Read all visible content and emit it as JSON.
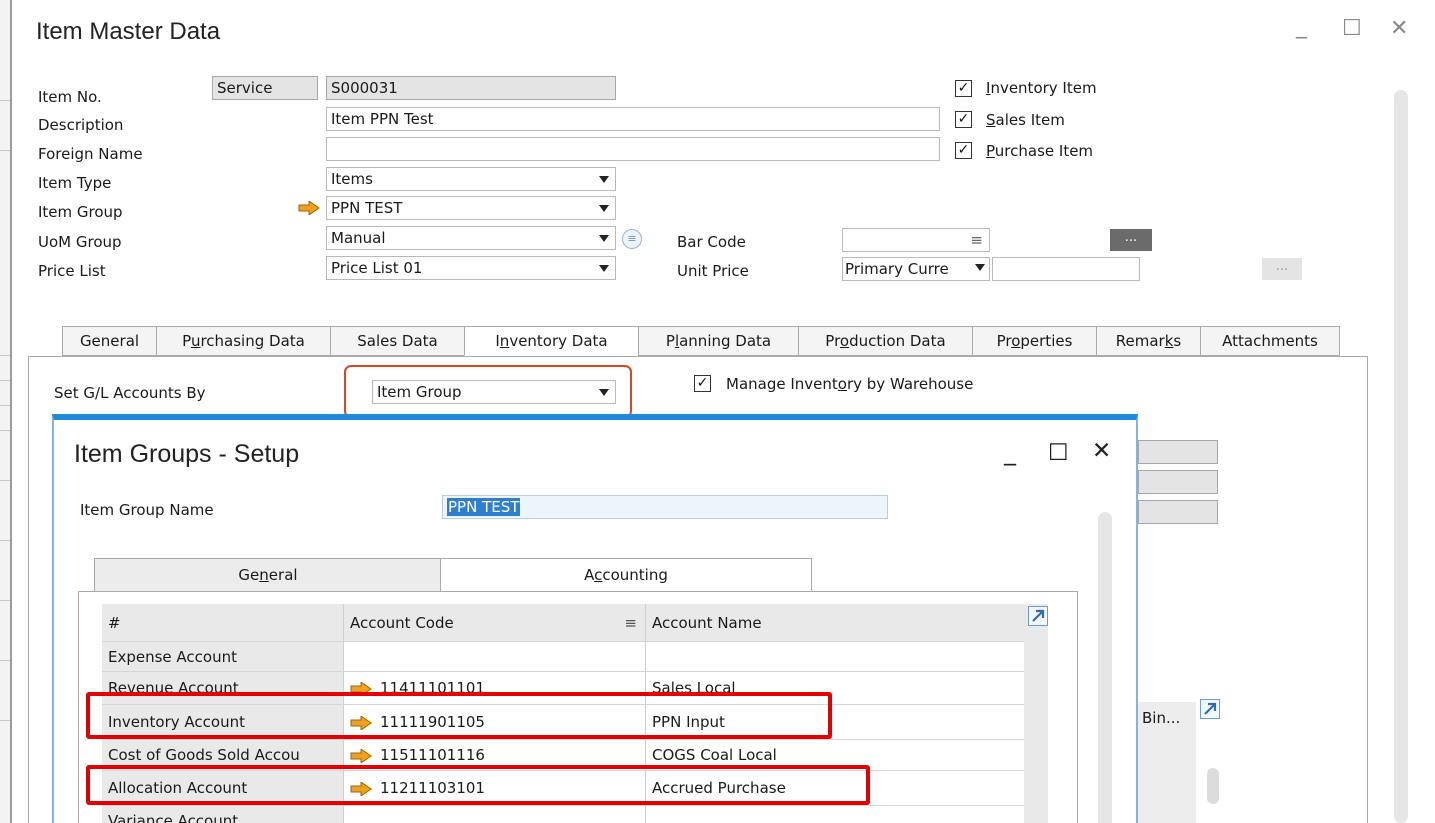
{
  "window": {
    "title": "Item Master Data",
    "controls": {
      "minimize": "_",
      "maximize": "☐",
      "close": "✕"
    }
  },
  "header": {
    "item_no_label": "Item No.",
    "item_no_type": "Service",
    "item_no_value": "S000031",
    "description_label": "Description",
    "description_value": "Item PPN Test",
    "foreign_name_label": "Foreign Name",
    "foreign_name_value": "",
    "item_type_label": "Item Type",
    "item_type_value": "Items",
    "item_group_label": "Item Group",
    "item_group_value": "PPN TEST",
    "uom_group_label": "UoM Group",
    "uom_group_value": "Manual",
    "price_list_label": "Price List",
    "price_list_value": "Price List 01",
    "bar_code_label": "Bar Code",
    "bar_code_value": "",
    "unit_price_label": "Unit Price",
    "unit_price_currency": "Primary Curre",
    "unit_price_value": "",
    "dots": "...",
    "checkboxes": [
      {
        "label_u": "I",
        "label_rest": "nventory Item",
        "checked": true
      },
      {
        "label_u": "S",
        "label_rest": "ales Item",
        "checked": true
      },
      {
        "label_u": "P",
        "label_rest": "urchase Item",
        "checked": true
      }
    ]
  },
  "tabs": [
    {
      "pre": "General",
      "u": "",
      "post": ""
    },
    {
      "pre": "P",
      "u": "u",
      "post": "rchasing Data"
    },
    {
      "pre": "Sales Data",
      "u": "",
      "post": ""
    },
    {
      "pre": "I",
      "u": "n",
      "post": "ventory Data"
    },
    {
      "pre": "P",
      "u": "l",
      "post": "anning Data"
    },
    {
      "pre": "Pr",
      "u": "o",
      "post": "duction Data"
    },
    {
      "pre": "Pr",
      "u": "o",
      "post": "perties"
    },
    {
      "pre": "Remar",
      "u": "k",
      "post": "s"
    },
    {
      "pre": "Attachments",
      "u": "",
      "post": ""
    }
  ],
  "inventory": {
    "gl_label": "Set G/L Accounts By",
    "gl_value": "Item Group",
    "manage_pre": "Manage Invent",
    "manage_u": "o",
    "manage_post": "ry by Warehouse",
    "manage_checked": true,
    "bin_label": "Bin..."
  },
  "dialog": {
    "title": "Item Groups - Setup",
    "controls": {
      "minimize": "_",
      "maximize": "☐",
      "close": "✕"
    },
    "group_name_label": "Item Group Name",
    "group_name_value": "PPN TEST",
    "tabs": [
      {
        "pre": "Ge",
        "u": "n",
        "post": "eral"
      },
      {
        "pre": "A",
        "u": "c",
        "post": "counting"
      }
    ],
    "columns": {
      "num": "#",
      "code": "Account Code",
      "name": "Account Name"
    },
    "rows": [
      {
        "account": "Expense Account",
        "code": "",
        "name": "",
        "link": false
      },
      {
        "account": "Revenue Account",
        "code": "11411101101",
        "name": "Sales Local",
        "link": true
      },
      {
        "account": "Inventory Account",
        "code": "11111901105",
        "name": "PPN Input",
        "link": true
      },
      {
        "account": "Cost of Goods Sold Accou",
        "code": "11511101116",
        "name": "COGS Coal Local",
        "link": true
      },
      {
        "account": "Allocation Account",
        "code": "11211103101",
        "name": "Accrued Purchase",
        "link": true
      },
      {
        "account": "Variance Account",
        "code": "",
        "name": "",
        "link": false
      }
    ]
  },
  "colors": {
    "highlight_red": "#e20000",
    "highlight_orange": "#d44a26",
    "dialog_accent": "#1f8ad9",
    "link_arrow": "#f0a020"
  }
}
